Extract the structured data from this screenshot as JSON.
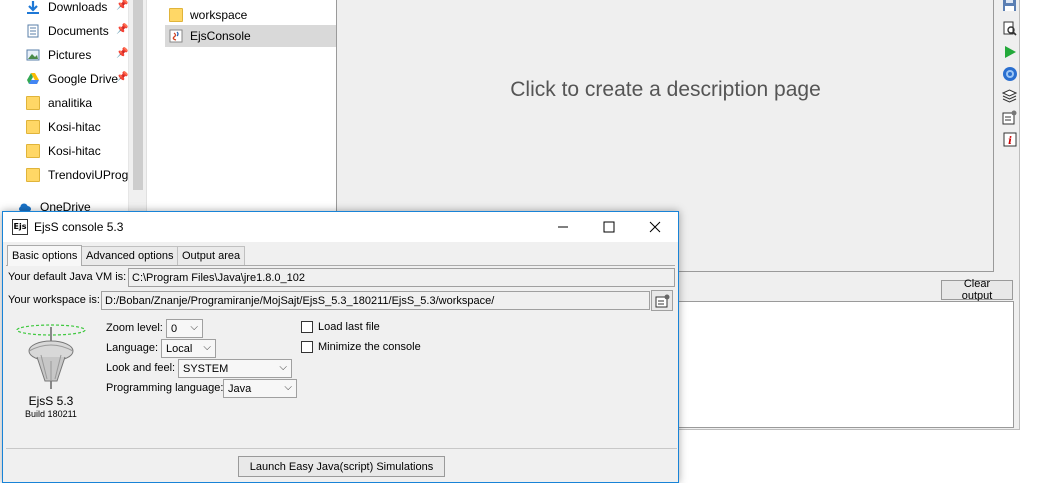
{
  "explorer": {
    "nav_items": [
      {
        "label": "Downloads",
        "icon": "download-icon",
        "pinned": true
      },
      {
        "label": "Documents",
        "icon": "document-icon",
        "pinned": true
      },
      {
        "label": "Pictures",
        "icon": "picture-icon",
        "pinned": true
      },
      {
        "label": "Google Drive",
        "icon": "google-drive-icon",
        "pinned": true
      },
      {
        "label": "analitika",
        "icon": "folder-icon",
        "pinned": false
      },
      {
        "label": "Kosi-hitac",
        "icon": "folder-icon",
        "pinned": false
      },
      {
        "label": "Kosi-hitac",
        "icon": "folder-icon",
        "pinned": false
      },
      {
        "label": "TrendoviUProgr",
        "icon": "folder-icon",
        "pinned": false
      },
      {
        "label": "OneDrive",
        "icon": "onedrive-icon",
        "pinned": false
      }
    ],
    "files": [
      {
        "label": "workspace",
        "icon": "folder-icon",
        "selected": false
      },
      {
        "label": "EjsConsole",
        "icon": "java-jar-icon",
        "selected": true
      }
    ]
  },
  "editor": {
    "description_placeholder": "Click to create a description page",
    "clear_output_label": "Clear output",
    "toolbar_icons": [
      "save-icon",
      "search-page-icon",
      "run-icon",
      "browser-icon",
      "layers-icon",
      "options-icon",
      "info-icon"
    ]
  },
  "console": {
    "title": "EjsS console 5.3",
    "app_icon_text": "Ejs",
    "tabs": [
      {
        "label": "Basic options",
        "active": true
      },
      {
        "label": "Advanced options",
        "active": false
      },
      {
        "label": "Output area",
        "active": false
      }
    ],
    "java_vm_label": "Your default Java VM is:",
    "java_vm_value": "C:\\Program Files\\Java\\jre1.8.0_102",
    "workspace_label": "Your workspace is:",
    "workspace_value": "D:/Boban/Znanje/Programiranje/MojSajt/EjsS_5.3_180211/EjsS_5.3/workspace/",
    "logo_name": "EjsS 5.3",
    "logo_build": "Build 180211",
    "zoom_label": "Zoom level:",
    "zoom_value": "0",
    "language_label": "Language:",
    "language_value": "Local",
    "look_label": "Look and feel:",
    "look_value": "SYSTEM",
    "prog_label": "Programming language:",
    "prog_value": "Java",
    "load_last_file_label": "Load last file",
    "load_last_file_checked": false,
    "minimize_label": "Minimize the console",
    "minimize_checked": false,
    "launch_label": "Launch Easy Java(script) Simulations"
  },
  "colors": {
    "accent": "#1883d7",
    "selection": "#d9d9d9",
    "folder": "#ffd766"
  }
}
